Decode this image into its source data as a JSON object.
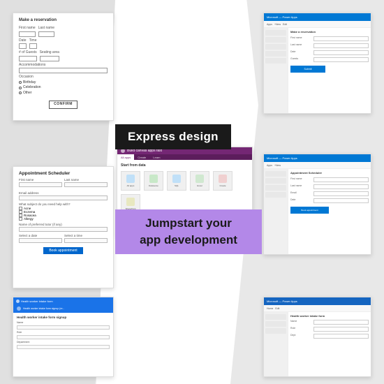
{
  "background": {
    "color_left": "#d8d8d8",
    "color_center": "#ffffff",
    "color_right": "#e4e4e4"
  },
  "labels": {
    "express_design": "Express design",
    "jumpstart_line1": "Jumpstart your",
    "jumpstart_line2": "app development"
  },
  "thumbnails": {
    "paper_wireframe": {
      "title": "Make a reservation",
      "fields": [
        "First name",
        "Last name",
        "Date",
        "Time",
        "# of Guests",
        "Seating area",
        "Accommodations",
        "Occasion"
      ],
      "radio_options": [
        "Birthday",
        "Celebration",
        "Other"
      ],
      "button": "CONFIRM"
    },
    "appointment": {
      "title": "Appointment Scheduler",
      "fields": [
        "First name",
        "Last name",
        "Email address"
      ],
      "checkboxes": [
        "Acne",
        "Eczema",
        "Rosacea",
        "Allergy"
      ],
      "button": "Book appointment"
    },
    "power_apps": {
      "titlebar": "Build canvas apps fast",
      "tabs": [
        "All apps",
        "Create",
        "Learn"
      ],
      "app_tiles": [
        {
          "name": "All apps",
          "color": "#e8f4fd"
        },
        {
          "name": "Dataverse",
          "color": "#e8f0e8"
        },
        {
          "name": "SQL",
          "color": "#e8f4fd"
        },
        {
          "name": "Excel",
          "color": "#e8f0e8"
        }
      ]
    },
    "right_screens": [
      {
        "title": "Microsoft — Power Apps"
      },
      {
        "title": "Microsoft — Power Apps"
      },
      {
        "title": "Microsoft — Power Apps"
      }
    ]
  }
}
